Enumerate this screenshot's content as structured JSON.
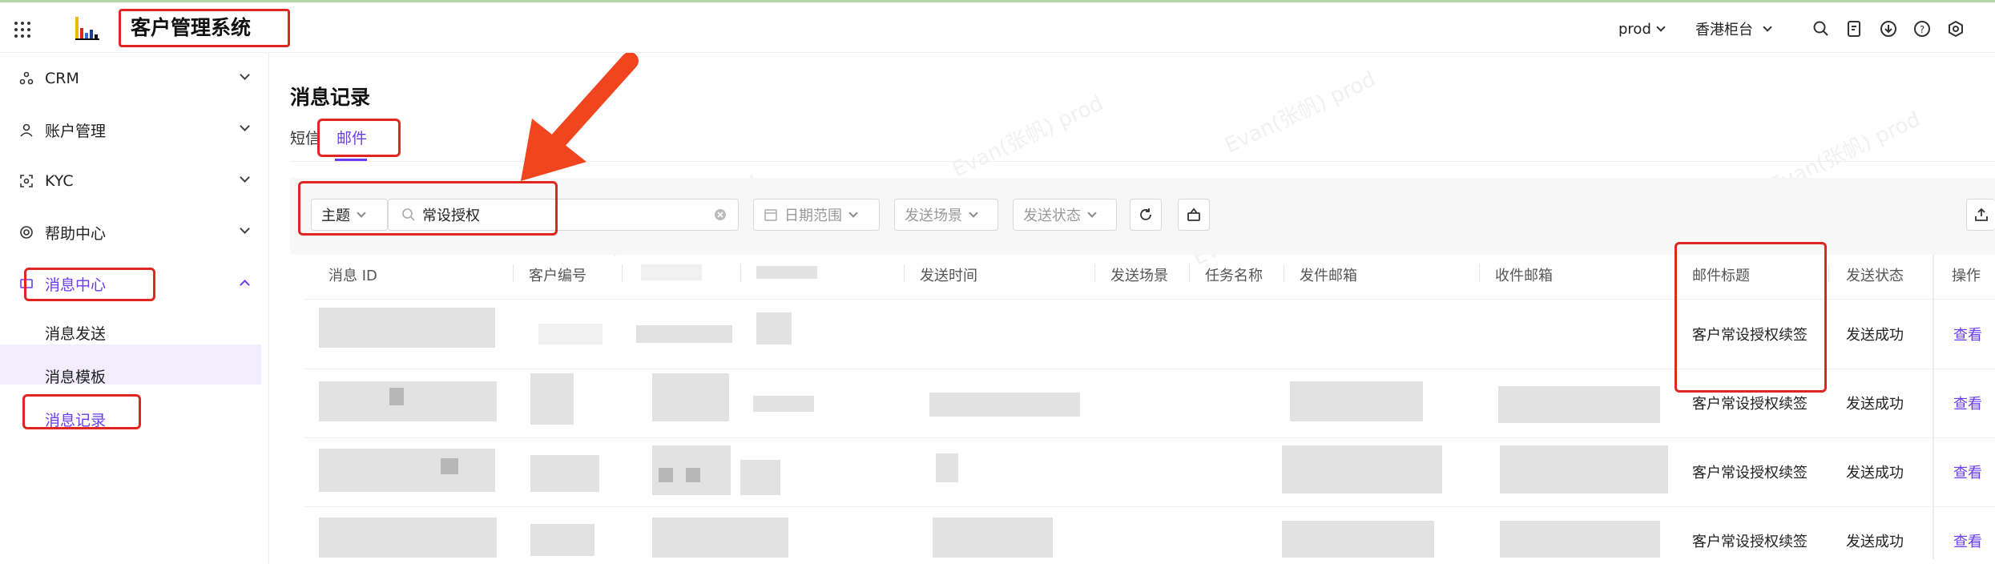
{
  "header": {
    "app_title": "客户管理系统",
    "env": "prod",
    "region": "香港柜台",
    "icons": [
      "apps-grid-icon",
      "search-icon",
      "document-icon",
      "download-icon",
      "help-icon",
      "settings-icon"
    ]
  },
  "sidebar": {
    "items": [
      {
        "label": "CRM",
        "icon": "org-icon"
      },
      {
        "label": "账户管理",
        "icon": "user-icon"
      },
      {
        "label": "KYC",
        "icon": "scan-icon"
      },
      {
        "label": "帮助中心",
        "icon": "lifebuoy-icon"
      },
      {
        "label": "消息中心",
        "icon": "message-icon"
      }
    ],
    "sub_items": [
      "消息发送",
      "消息模板",
      "消息记录"
    ]
  },
  "page": {
    "title": "消息记录",
    "tabs": [
      "短信",
      "邮件"
    ],
    "active_tab": "邮件"
  },
  "filters": {
    "field_select": "主题",
    "search_value": "常设授权",
    "date_placeholder": "日期范围",
    "scene_placeholder": "发送场景",
    "status_placeholder": "发送状态"
  },
  "table": {
    "columns": [
      "消息 ID",
      "客户编号",
      "发送时间",
      "发送场景",
      "任务名称",
      "发件邮箱",
      "收件邮箱",
      "邮件标题",
      "发送状态",
      "操作"
    ],
    "rows": [
      {
        "subject": "客户常设授权续签",
        "status": "发送成功",
        "action": "查看"
      },
      {
        "subject": "客户常设授权续签",
        "status": "发送成功",
        "action": "查看"
      },
      {
        "subject": "客户常设授权续签",
        "status": "发送成功",
        "action": "查看"
      },
      {
        "subject": "客户常设授权续签",
        "status": "发送成功",
        "action": "查看"
      }
    ]
  },
  "watermark": "Evan(张帆) prod",
  "colors": {
    "accent": "#6b3df0",
    "annotation": "#e0261f",
    "arrow": "#f0451e"
  }
}
